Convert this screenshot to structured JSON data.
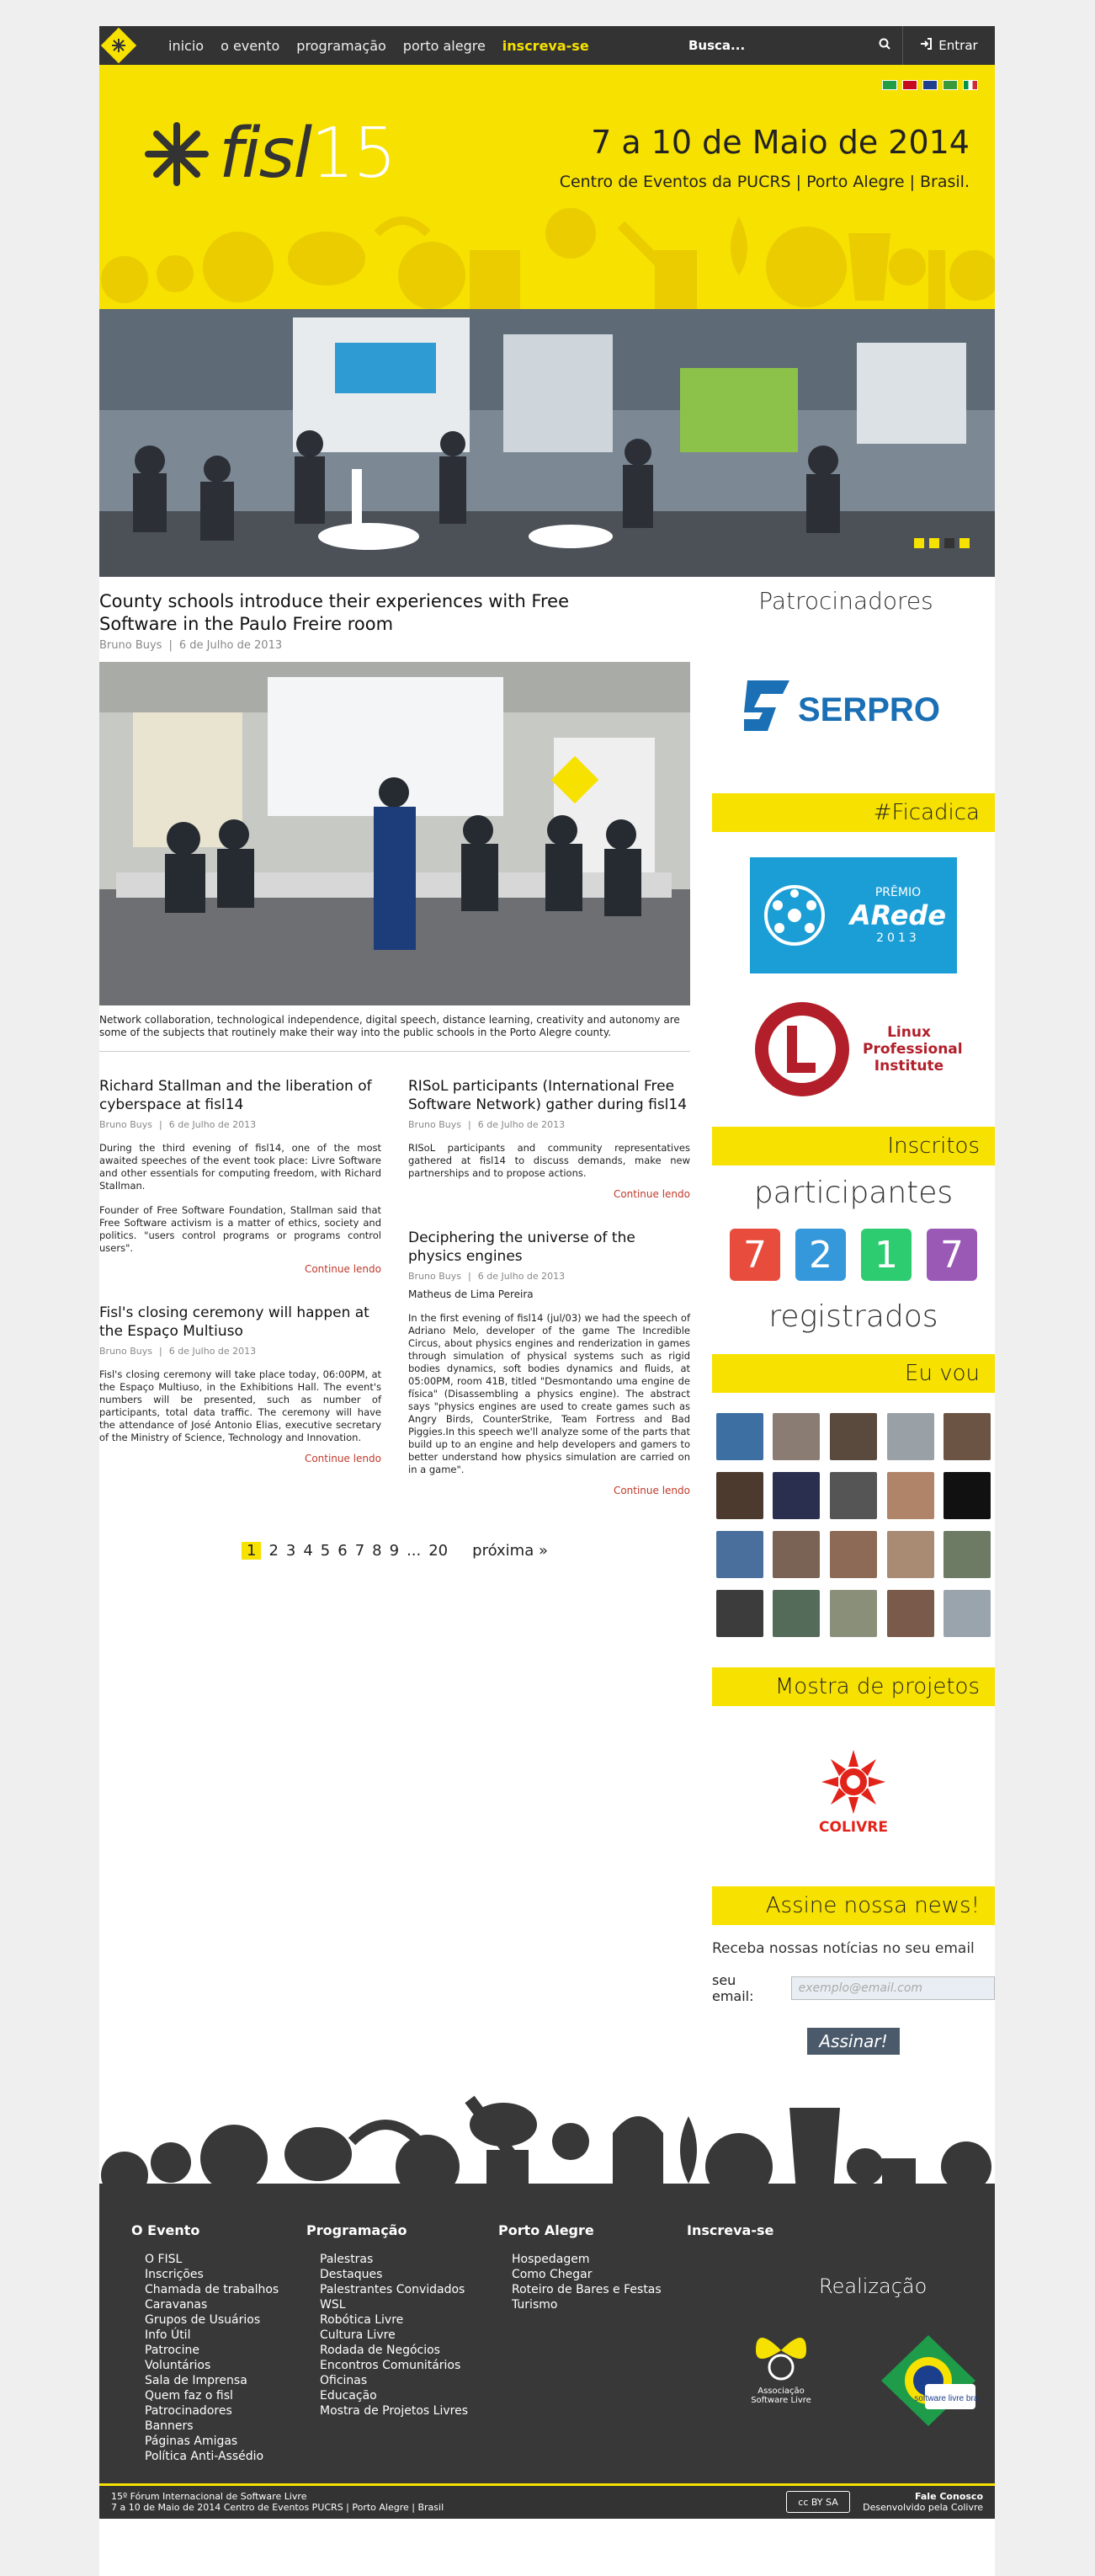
{
  "nav": {
    "links": [
      "inicio",
      "o evento",
      "programação",
      "porto alegre"
    ],
    "cta": "inscreva-se",
    "search_placeholder": "Busca...",
    "login": "Entrar"
  },
  "banner": {
    "brand_prefix": "fisl",
    "brand_number": "15",
    "date": "7 a 10 de Maio de 2014",
    "place": "Centro de Eventos da PUCRS | Porto Alegre | Brasil."
  },
  "featured": {
    "title": "County schools introduce their experiences with Free Software in the Paulo Freire room",
    "author": "Bruno Buys",
    "date": "6 de Julho de 2013",
    "caption": "Network collaboration, technological independence, digital speech, distance learning, creativity and autonomy are some of the subjects that routinely make their way into the public schools in the Porto Alegre county."
  },
  "posts_left": [
    {
      "title": "Richard Stallman and the liberation of cyberspace at fisl14",
      "author": "Bruno Buys",
      "date": "6 de Julho de 2013",
      "p1": "During the third evening of fisl14, one of the most awaited speeches of the event took place: Livre Software and other essentials for computing freedom, with Richard Stallman.",
      "p2": "Founder of Free Software Foundation, Stallman said that Free Software activism is a matter of ethics, society and politics. \"users control programs or programs control users\".",
      "more": "Continue lendo"
    },
    {
      "title": "Fisl's closing ceremony will happen at the Espaço Multiuso",
      "author": "Bruno Buys",
      "date": "6 de Julho de 2013",
      "p1": "Fisl's closing ceremony will take place today, 06:00PM, at the Espaço Multiuso, in the Exhibitions Hall. The event's numbers will be presented, such as number of participants, total data traffic. The ceremony will have the attendance of José Antonio Elias, executive secretary of the Ministry of Science, Technology and Innovation.",
      "more": "Continue lendo"
    }
  ],
  "posts_right": [
    {
      "title": "RISoL participants (International Free Software Network) gather during fisl14",
      "author": "Bruno Buys",
      "date": "6 de Julho de 2013",
      "p1": "RISoL participants and community representatives gathered at fisl14 to discuss demands, make new partnerships and to propose actions.",
      "more": "Continue lendo"
    },
    {
      "title": "Deciphering the universe of the physics engines",
      "author": "Bruno Buys",
      "date": "6 de Julho de 2013",
      "byline": "Matheus de Lima Pereira",
      "p1": "In the first evening of fisl14 (jul/03) we had the speech of Adriano Melo, developer of the game The Incredible Circus, about physics engines and renderization in games through simulation of physical systems such as rigid bodies dynamics, soft bodies dynamics and fluids, at 05:00PM, room 41B, titled \"Desmontando uma engine de física\" (Disassembling a physics engine). The abstract says \"physics engines are used to create games such as Angry Birds, CounterStrike, Team Fortress and Bad Piggies.In this speech we'll analyze some of the parts that build up to an engine and help developers and gamers to better understand how physics simulation are carried on in a game\".",
      "more": "Continue lendo"
    }
  ],
  "pager": {
    "pages": [
      "1",
      "2",
      "3",
      "4",
      "5",
      "6",
      "7",
      "8",
      "9",
      "...",
      "20"
    ],
    "next": "próxima"
  },
  "sidebar": {
    "sponsors": "Patrocinadores",
    "sponsor1": "SERPRO",
    "ficadica": "#Ficadica",
    "premio_top": "PRÊMIO",
    "premio_name": "ARede",
    "premio_year": "2013",
    "lpi": "Linux Professional Institute",
    "inscritos": "Inscritos",
    "participants": "participantes",
    "digits": [
      "7",
      "2",
      "1",
      "7"
    ],
    "digit_colors": [
      "#e74c3c",
      "#3498db",
      "#2ecc71",
      "#9b59b6"
    ],
    "registered": "registrados",
    "euvou": "Eu vou",
    "mostra": "Mostra de projetos",
    "colivre": "COLIVRE",
    "news_h": "Assine nossa news!",
    "news_text": "Receba nossas notícias no seu email",
    "email_label": "seu email:",
    "email_placeholder": "exemplo@email.com",
    "subscribe": "Assinar!"
  },
  "footer": {
    "col1_title": "O Evento",
    "col1": [
      "O FISL",
      "Inscrições",
      "Chamada de trabalhos",
      "Caravanas",
      "Grupos de Usuários",
      "Info Útil",
      "Patrocine",
      "Voluntários",
      "Sala de Imprensa",
      "Quem faz o fisl",
      "Patrocinadores",
      "Banners",
      "Páginas Amigas",
      "Política Anti-Assédio"
    ],
    "col2_title": "Programação",
    "col2": [
      "Palestras",
      "Destaques",
      "Palestrantes Convidados",
      "WSL",
      "Robótica Livre",
      "Cultura Livre",
      "Rodada de Negócios",
      "Encontros Comunitários",
      "Oficinas",
      "Educação",
      "Mostra de Projetos Livres"
    ],
    "col3_title": "Porto Alegre",
    "col3": [
      "Hospedagem",
      "Como Chegar",
      "Roteiro de Bares e Festas",
      "Turismo"
    ],
    "col4_title": "Inscreva-se",
    "realizacao": "Realização",
    "asl": "Associação Software Livre",
    "swl": "software livre brasil",
    "bottom_line1": "15º Fórum Internacional de Software Livre",
    "bottom_line2": "7 a 10 de Maio de 2014 Centro de Eventos PUCRS | Porto Alegre | Brasil",
    "contact": "Fale Conosco",
    "dev": "Desenvolvido pela Colivre",
    "cc": "cc BY SA"
  }
}
